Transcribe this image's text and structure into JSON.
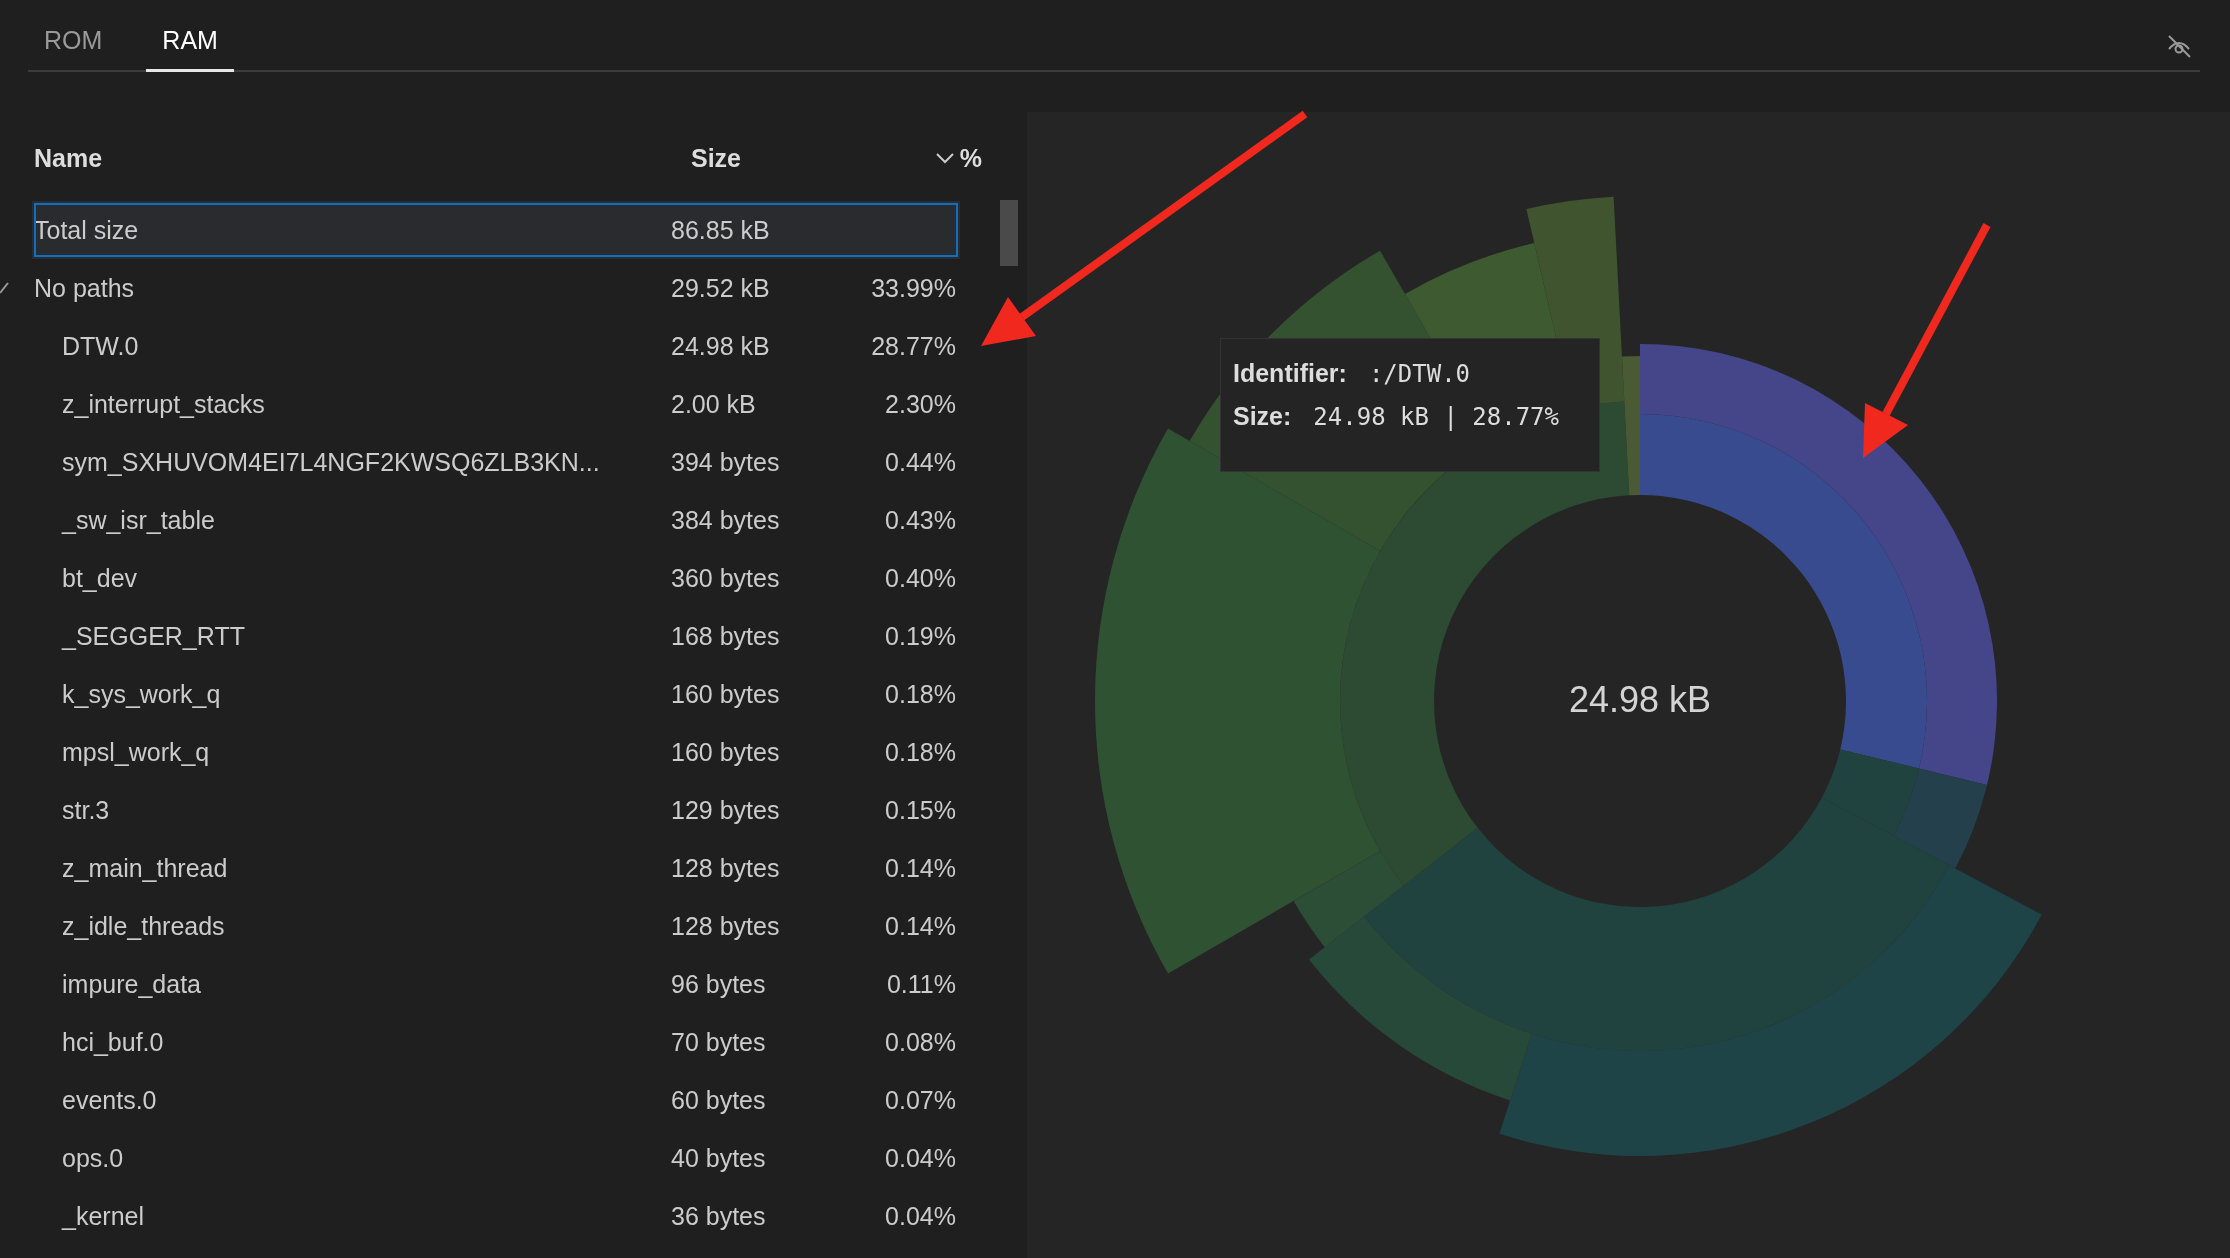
{
  "tabs": [
    {
      "label": "ROM",
      "selected": false
    },
    {
      "label": "RAM",
      "selected": true
    }
  ],
  "table": {
    "columns": [
      {
        "label": "Name"
      },
      {
        "label": "Size"
      },
      {
        "label": "%",
        "sorted": true
      }
    ],
    "rows": [
      {
        "name": "Total size",
        "size": "86.85 kB",
        "selected": true
      },
      {
        "name": "No paths",
        "size": "29.52 kB",
        "percent": "33.99%",
        "selected": false,
        "expanded": true,
        "children": [
          {
            "name": "DTW.0",
            "size": "24.98 kB",
            "percent": "28.77%",
            "selected": false
          },
          {
            "name": "z_interrupt_stacks",
            "size": "2.00 kB",
            "percent": "2.30%",
            "selected": false
          },
          {
            "name": "sym_SXHUVOM4EI7L4NGF2KWSQ6ZLB3KN...",
            "size": "394 bytes",
            "percent": "0.44%",
            "selected": false
          },
          {
            "name": "_sw_isr_table",
            "size": "384 bytes",
            "percent": "0.43%",
            "selected": false
          },
          {
            "name": "bt_dev",
            "size": "360 bytes",
            "percent": "0.40%",
            "selected": false
          },
          {
            "name": "_SEGGER_RTT",
            "size": "168 bytes",
            "percent": "0.19%",
            "selected": false
          },
          {
            "name": "k_sys_work_q",
            "size": "160 bytes",
            "percent": "0.18%",
            "selected": false
          },
          {
            "name": "mpsl_work_q",
            "size": "160 bytes",
            "percent": "0.18%",
            "selected": false
          },
          {
            "name": "str.3",
            "size": "129 bytes",
            "percent": "0.15%",
            "selected": false
          },
          {
            "name": "z_main_thread",
            "size": "128 bytes",
            "percent": "0.14%",
            "selected": false
          },
          {
            "name": "z_idle_threads",
            "size": "128 bytes",
            "percent": "0.14%",
            "selected": false
          },
          {
            "name": "impure_data",
            "size": "96 bytes",
            "percent": "0.11%",
            "selected": false
          },
          {
            "name": "hci_buf.0",
            "size": "70 bytes",
            "percent": "0.08%",
            "selected": false
          },
          {
            "name": "events.0",
            "size": "60 bytes",
            "percent": "0.07%",
            "selected": false
          },
          {
            "name": "ops.0",
            "size": "40 bytes",
            "percent": "0.04%",
            "selected": false
          },
          {
            "name": "_kernel",
            "size": "36 bytes",
            "percent": "0.04%",
            "selected": false
          }
        ]
      }
    ]
  },
  "chart": {
    "center_label": "24.98 kB",
    "tooltip": {
      "identifier_label": "Identifier:",
      "identifier": ":/DTW.0",
      "size_label": "Size:",
      "size": "24.98 kB | 28.77%"
    }
  }
}
